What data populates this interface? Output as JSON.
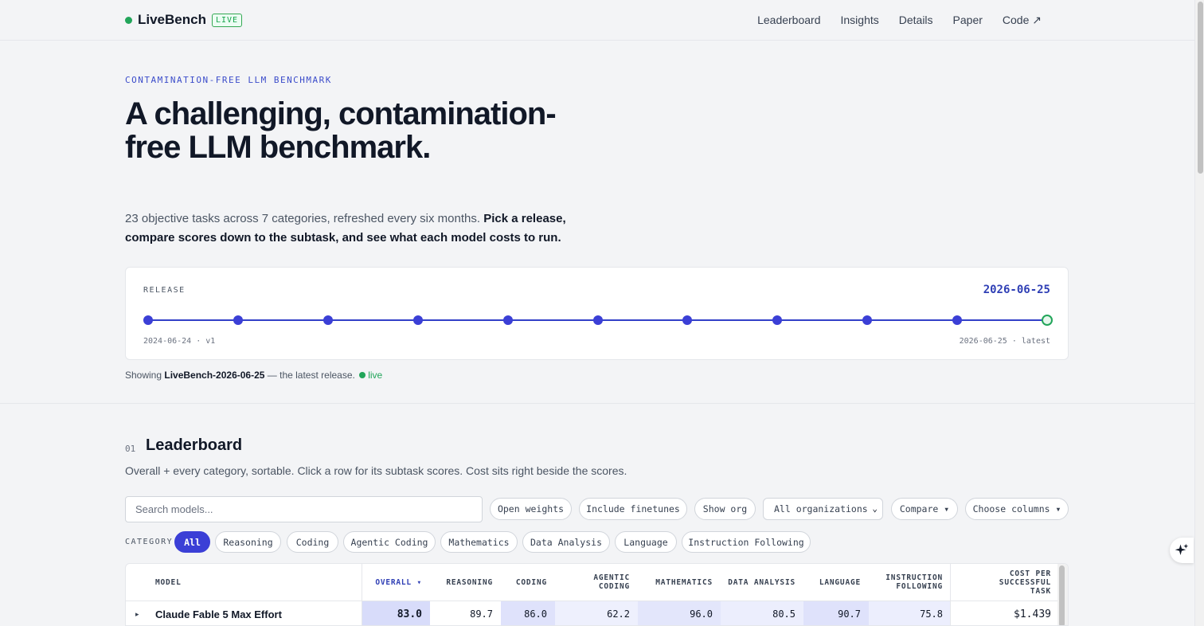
{
  "header": {
    "brand": "LiveBench",
    "badge": "LIVE",
    "nav": [
      "Leaderboard",
      "Insights",
      "Details",
      "Paper",
      "Code ↗"
    ]
  },
  "hero": {
    "eyebrow": "CONTAMINATION-FREE LLM BENCHMARK",
    "title": "A challenging, contamination-free LLM benchmark.",
    "subtitle_plain": "23 objective tasks across 7 categories, refreshed every six months. ",
    "subtitle_bold": "Pick a release, compare scores down to the subtask, and see what each model costs to run."
  },
  "release": {
    "label": "RELEASE",
    "selected_date": "2026-06-25",
    "start_label": "2024-06-24 · v1",
    "end_label": "2026-06-25 · latest",
    "point_count": 11
  },
  "showing": {
    "prefix": "Showing ",
    "release_name": "LiveBench-2026-06-25",
    "suffix": " — the latest release. ",
    "live": "live"
  },
  "leaderboard": {
    "number": "01",
    "title": "Leaderboard",
    "description": "Overall + every category, sortable. Click a row for its subtask scores. Cost sits right beside the scores.",
    "search_placeholder": "Search models...",
    "toggles": [
      "Open weights",
      "Include finetunes",
      "Show org"
    ],
    "org_select": "All organizations",
    "compare": "Compare ▾",
    "columns": "Choose columns ▾",
    "category_label": "CATEGORY",
    "categories": [
      "All",
      "Reasoning",
      "Coding",
      "Agentic Coding",
      "Mathematics",
      "Data Analysis",
      "Language",
      "Instruction Following"
    ],
    "active_category": "All",
    "table": {
      "headers": [
        "MODEL",
        "OVERALL ▾",
        "REASONING",
        "CODING",
        "AGENTIC CODING",
        "MATHEMATICS",
        "DATA ANALYSIS",
        "LANGUAGE",
        "INSTRUCTION FOLLOWING",
        "COST PER SUCCESSFUL TASK"
      ],
      "rows": [
        {
          "expander": "▸",
          "model": "Claude Fable 5 Max Effort",
          "overall": "83.0",
          "reasoning": "89.7",
          "coding": "86.0",
          "agentic_coding": "62.2",
          "mathematics": "96.0",
          "data_analysis": "80.5",
          "language": "90.7",
          "instruction_following": "75.8",
          "cost": "$1.439"
        }
      ]
    }
  },
  "colors": {
    "accent": "#3b3fd6",
    "live_green": "#22a55a",
    "background": "#f3f4f6"
  }
}
